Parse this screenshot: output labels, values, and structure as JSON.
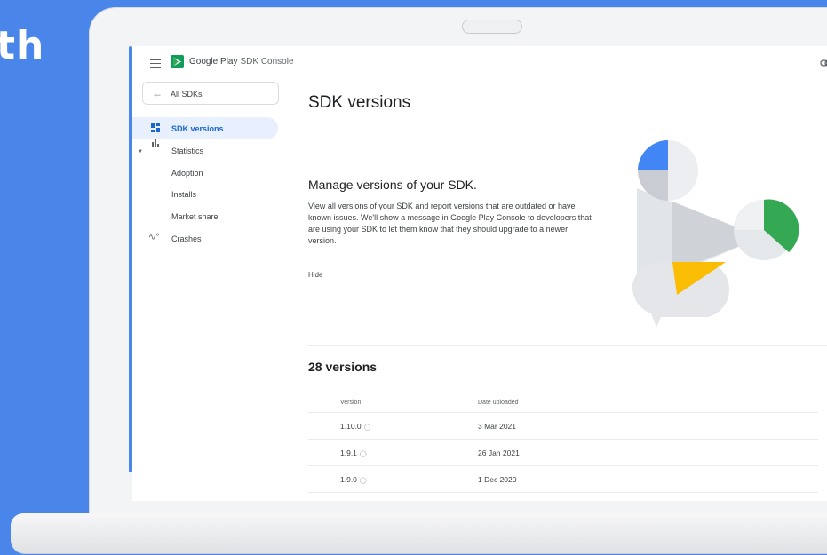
{
  "background": {
    "text": "th"
  },
  "header": {
    "brand": "Google Play",
    "brand_sub": "SDK Console",
    "link_icon": "link-icon"
  },
  "sidebar": {
    "back_label": "All SDKs",
    "items": [
      {
        "label": "SDK versions",
        "icon": "versions-icon",
        "active": true
      },
      {
        "label": "Statistics",
        "icon": "statistics-icon"
      },
      {
        "label": "Adoption"
      },
      {
        "label": "Installs"
      },
      {
        "label": "Market share"
      },
      {
        "label": "Crashes",
        "icon": "crashes-icon"
      }
    ]
  },
  "main": {
    "title": "SDK versions",
    "banner": {
      "heading": "Manage versions of your SDK.",
      "description": "View all versions of your SDK and report versions that are outdated or have known issues. We'll show a message in Google Play Console to developers that are using your SDK to let them know that they should upgrade to a newer version.",
      "hide_label": "Hide"
    },
    "versions": {
      "count_label": "28 versions",
      "columns": [
        "Version",
        "Date uploaded"
      ],
      "rows": [
        {
          "version": "1.10.0",
          "date": "3 Mar 2021"
        },
        {
          "version": "1.9.1",
          "date": "26 Jan 2021"
        },
        {
          "version": "1.9.0",
          "date": "1 Dec 2020"
        }
      ]
    }
  },
  "colors": {
    "accent": "#1967d2",
    "background": "#4a86ea",
    "illus_blue": "#4285f4",
    "illus_green": "#34a853",
    "illus_yellow": "#fbbc04"
  }
}
